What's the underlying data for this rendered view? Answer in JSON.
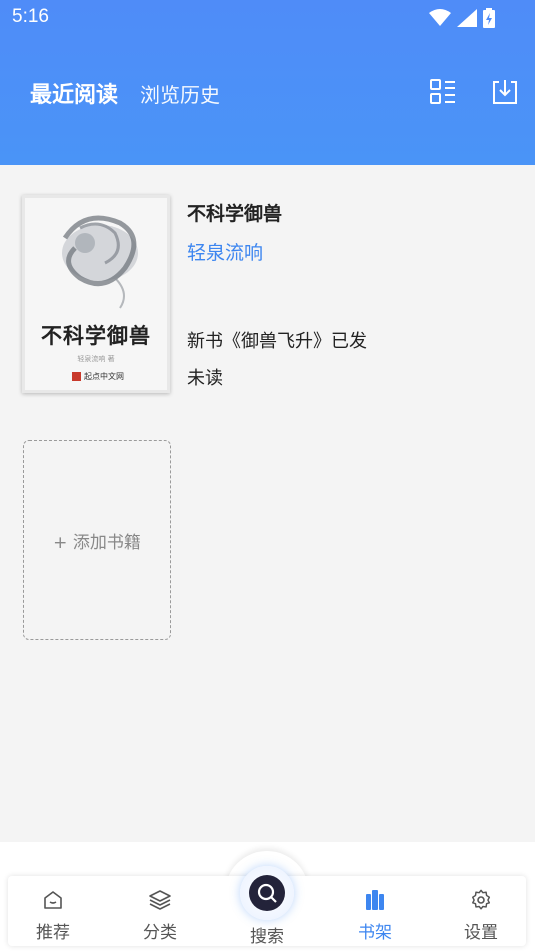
{
  "status": {
    "time": "5:16"
  },
  "header": {
    "tab_recent": "最近阅读",
    "tab_history": "浏览历史"
  },
  "book": {
    "title": "不科学御兽",
    "author": "轻泉流响",
    "latest": "新书《御兽飞升》已发",
    "progress": "未读",
    "cover_title": "不科学御兽",
    "cover_author": "轻泉流响 著",
    "cover_publisher": "起点中文网"
  },
  "add_book": {
    "label": "+ 添加书籍"
  },
  "nav": {
    "items": [
      {
        "label": "推荐",
        "icon": "home-icon"
      },
      {
        "label": "分类",
        "icon": "layers-icon"
      },
      {
        "label": "搜索",
        "icon": "search-icon"
      },
      {
        "label": "书架",
        "icon": "bookshelf-icon"
      },
      {
        "label": "设置",
        "icon": "gear-icon"
      }
    ],
    "active_index": 3
  },
  "colors": {
    "header": "#4f8cf8",
    "accent": "#3d86f0"
  }
}
